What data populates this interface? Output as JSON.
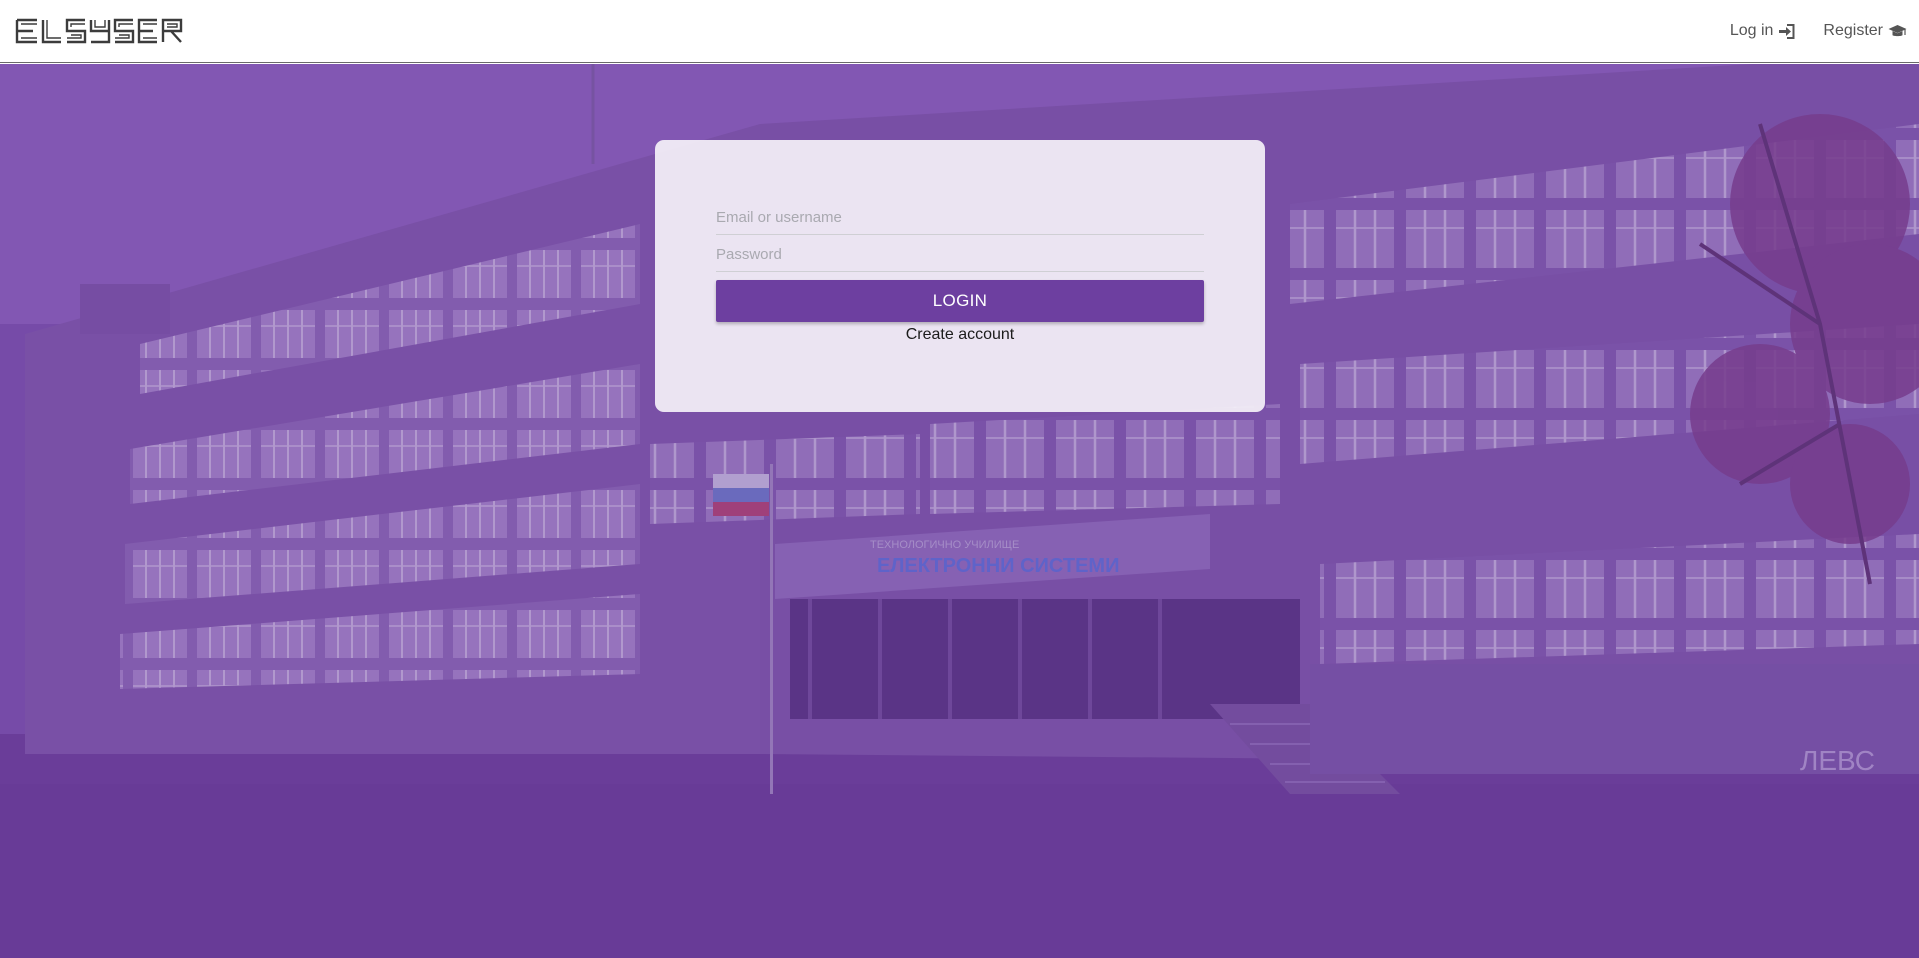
{
  "header": {
    "logo_text": "ELSYSER",
    "nav": {
      "login_label": "Log in",
      "register_label": "Register"
    }
  },
  "hero": {
    "sign_line_1": "ТЕХНОЛОГИЧНО УЧИЛИЩЕ",
    "sign_line_2": "ЕЛЕКТРОННИ СИСТЕМИ",
    "graffiti_text": "ЛЕВС",
    "overlay_color": "#6c3f9b"
  },
  "login_form": {
    "email_placeholder": "Email or username",
    "email_value": "",
    "password_placeholder": "Password",
    "password_value": "",
    "submit_label": "LOGIN",
    "create_account_label": "Create account"
  },
  "colors": {
    "accent": "#6d3fa0",
    "header_bg": "#ffffff"
  },
  "icons": {
    "login": "sign-in-icon",
    "register": "graduation-cap-icon"
  }
}
